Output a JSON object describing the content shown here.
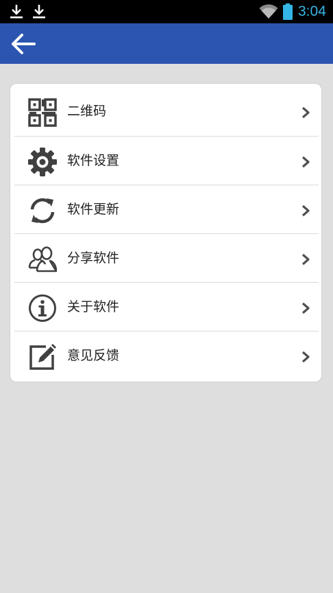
{
  "status_bar": {
    "time": "3:04",
    "icons": [
      "download-icon",
      "download-icon",
      "wifi-icon",
      "battery-icon"
    ],
    "time_color": "#33b5e5"
  },
  "action_bar": {
    "color": "#2b55b0",
    "back_icon": "arrow-left-icon"
  },
  "menu": {
    "items": [
      {
        "label": "二维码",
        "icon": "qr-code-icon"
      },
      {
        "label": "软件设置",
        "icon": "gear-icon"
      },
      {
        "label": "软件更新",
        "icon": "refresh-icon"
      },
      {
        "label": "分享软件",
        "icon": "users-icon"
      },
      {
        "label": "关于软件",
        "icon": "info-icon"
      },
      {
        "label": "意见反馈",
        "icon": "edit-icon"
      }
    ],
    "chevron_icon": "chevron-right-icon"
  }
}
